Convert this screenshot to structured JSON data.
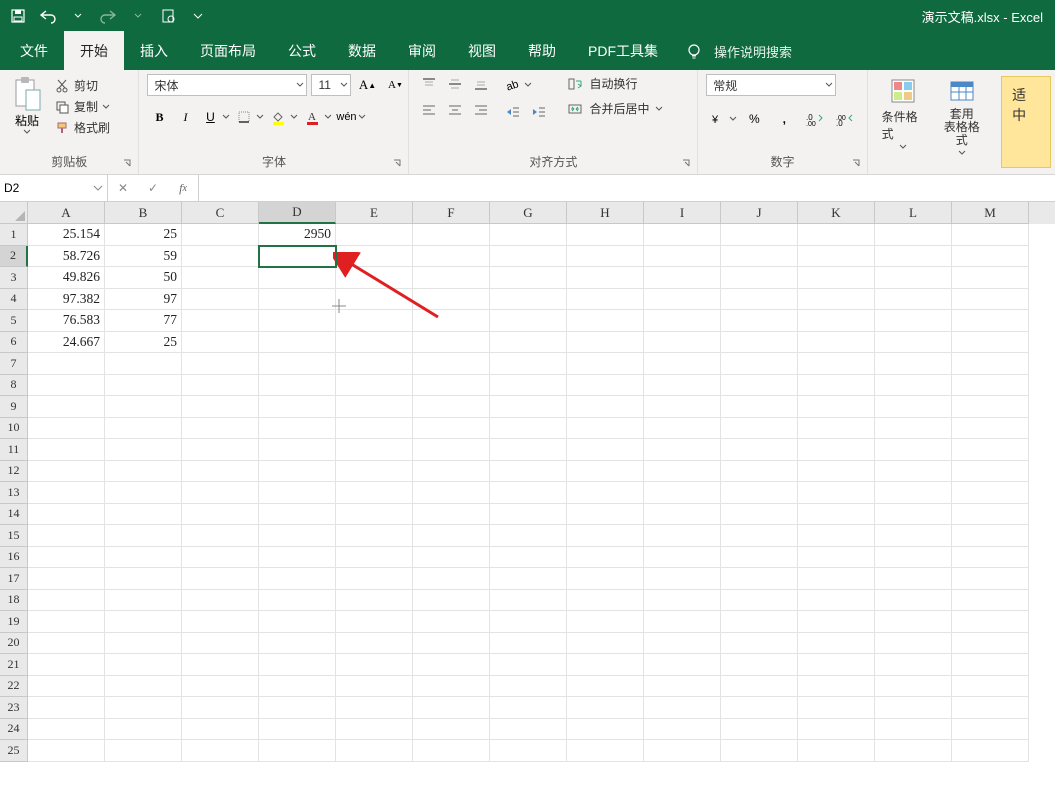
{
  "title": "演示文稿.xlsx - Excel",
  "tabs": {
    "file": "文件",
    "home": "开始",
    "insert": "插入",
    "layout": "页面布局",
    "formulas": "公式",
    "data": "数据",
    "review": "审阅",
    "view": "视图",
    "help": "帮助",
    "pdf": "PDF工具集",
    "search": "操作说明搜索"
  },
  "ribbon": {
    "clipboard": {
      "paste": "粘贴",
      "cut": "剪切",
      "copy": "复制",
      "format_painter": "格式刷",
      "label": "剪贴板"
    },
    "font": {
      "name": "宋体",
      "size": "11",
      "label": "字体"
    },
    "alignment": {
      "wrap": "自动换行",
      "merge": "合并后居中",
      "label": "对齐方式"
    },
    "number": {
      "format": "常规",
      "label": "数字"
    },
    "styles": {
      "cond": "条件格式",
      "table": "套用\n表格格式",
      "fit": "适中"
    }
  },
  "formula_bar": {
    "name_box": "D2",
    "formula": ""
  },
  "columns": [
    "A",
    "B",
    "C",
    "D",
    "E",
    "F",
    "G",
    "H",
    "I",
    "J",
    "K",
    "L",
    "M"
  ],
  "row_count": 25,
  "selected_cell": {
    "row": 2,
    "col": "D"
  },
  "cells": {
    "A1": "25.154",
    "B1": "25",
    "D1": "2950",
    "A2": "58.726",
    "B2": "59",
    "A3": "49.826",
    "B3": "50",
    "A4": "97.382",
    "B4": "97",
    "A5": "76.583",
    "B5": "77",
    "A6": "24.667",
    "B6": "25"
  }
}
